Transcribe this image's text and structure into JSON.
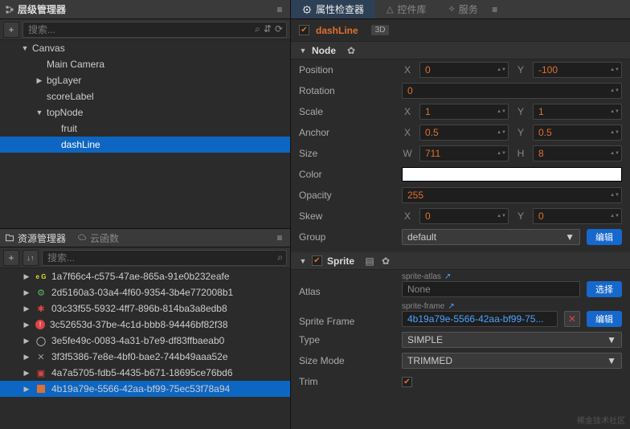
{
  "leftTop": {
    "title": "层级管理器",
    "searchPlaceholder": "搜索..."
  },
  "hierarchy": [
    {
      "depth": 1,
      "label": "Canvas",
      "arrow": "down"
    },
    {
      "depth": 2,
      "label": "Main Camera"
    },
    {
      "depth": 2,
      "label": "bgLayer",
      "arrow": "right"
    },
    {
      "depth": 2,
      "label": "scoreLabel"
    },
    {
      "depth": 2,
      "label": "topNode",
      "arrow": "down"
    },
    {
      "depth": 3,
      "label": "fruit"
    },
    {
      "depth": 3,
      "label": "dashLine",
      "selected": true
    }
  ],
  "assetsPanel": {
    "tab1": "资源管理器",
    "tab2": "云函数",
    "searchPlaceholder": "搜索..."
  },
  "assets": [
    {
      "icon": "js",
      "name": "1a7f66c4-c575-47ae-865a-91e0b232eafe",
      "arrow": true
    },
    {
      "icon": "prefab",
      "name": "2d5160a3-03a4-4f60-9354-3b4e772008b1",
      "arrow": true
    },
    {
      "icon": "red",
      "name": "03c33f55-5932-4ff7-896b-814ba3a8edb8",
      "arrow": true
    },
    {
      "icon": "ex",
      "name": "3c52653d-37be-4c1d-bbb8-94446bf82f38",
      "arrow": true
    },
    {
      "icon": "white",
      "name": "3e5fe49c-0083-4a31-b7e9-df83ffbaeab0",
      "arrow": true
    },
    {
      "icon": "x",
      "name": "3f3f5386-7e8e-4bf0-bae2-744b49aaa52e",
      "arrow": true
    },
    {
      "icon": "gift",
      "name": "4a7a5705-fdb5-4435-b671-18695ce76bd6",
      "arrow": true
    },
    {
      "icon": "orange",
      "name": "4b19a79e-5566-42aa-bf99-75ec53f78a94",
      "arrow": true,
      "selected": true
    }
  ],
  "inspector": {
    "tabs": {
      "inspector": "属性检查器",
      "widgets": "控件库",
      "services": "服务"
    },
    "nodeName": "dashLine",
    "pill3D": "3D",
    "sectionNode": "Node",
    "sectionSprite": "Sprite",
    "labels": {
      "Position": "Position",
      "Rotation": "Rotation",
      "Scale": "Scale",
      "Anchor": "Anchor",
      "Size": "Size",
      "Color": "Color",
      "Opacity": "Opacity",
      "Skew": "Skew",
      "Group": "Group",
      "Atlas": "Atlas",
      "SpriteFrame": "Sprite Frame",
      "Type": "Type",
      "SizeMode": "Size Mode",
      "Trim": "Trim"
    },
    "axis": {
      "X": "X",
      "Y": "Y",
      "W": "W",
      "H": "H"
    },
    "vals": {
      "posX": "0",
      "posY": "-100",
      "rotation": "0",
      "scaleX": "1",
      "scaleY": "1",
      "anchorX": "0.5",
      "anchorY": "0.5",
      "sizeW": "711",
      "sizeH": "8",
      "opacity": "255",
      "skewX": "0",
      "skewY": "0",
      "group": "default",
      "atlasHdr": "sprite-atlas",
      "atlasVal": "None",
      "frameHdr": "sprite-frame",
      "frameVal": "4b19a79e-5566-42aa-bf99-75...",
      "type": "SIMPLE",
      "sizeMode": "TRIMMED"
    },
    "btns": {
      "edit": "编辑",
      "select": "选择"
    }
  },
  "watermark": "稀金技术社区"
}
